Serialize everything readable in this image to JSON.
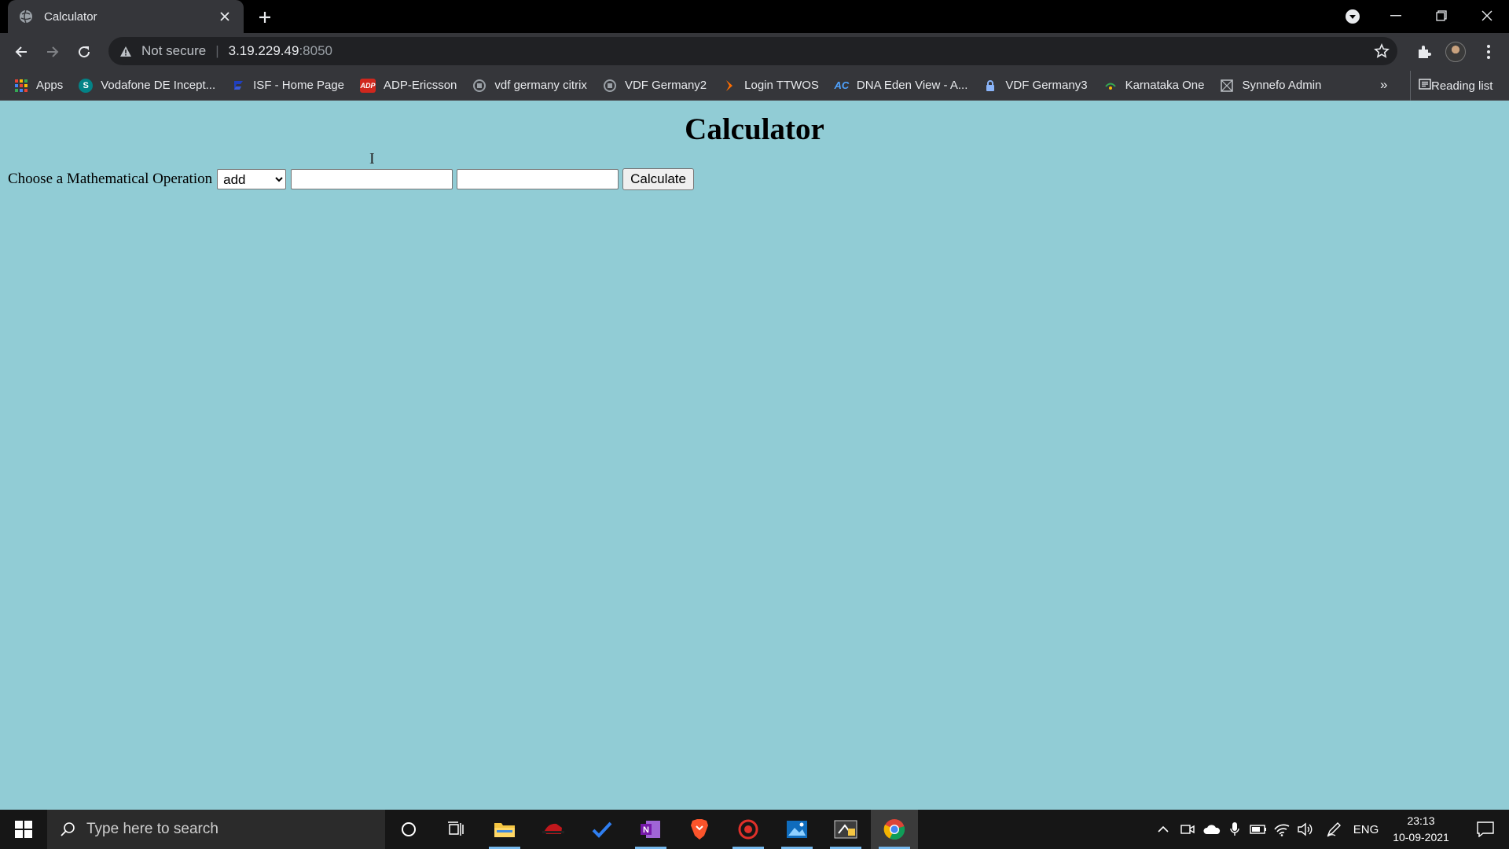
{
  "browser": {
    "tab": {
      "title": "Calculator"
    },
    "address": {
      "not_secure": "Not secure",
      "host": "3.19.229.49",
      "port": ":8050"
    },
    "bookmarks": [
      {
        "label": "Apps",
        "icon": "apps-grid-icon",
        "color": "#4285f4"
      },
      {
        "label": "Vodafone DE Incept...",
        "icon": "sharepoint-icon",
        "color": "#038387"
      },
      {
        "label": "ISF - Home Page",
        "icon": "isf-icon",
        "color": "#1f3fbf"
      },
      {
        "label": "ADP-Ericsson",
        "icon": "adp-icon",
        "color": "#d0271d"
      },
      {
        "label": "vdf germany citrix",
        "icon": "citrix-icon",
        "color": "#9aa0a6"
      },
      {
        "label": "VDF Germany2",
        "icon": "citrix-icon",
        "color": "#9aa0a6"
      },
      {
        "label": "Login TTWOS",
        "icon": "ttwos-icon",
        "color": "#ff6d00"
      },
      {
        "label": "DNA Eden View - A...",
        "icon": "dna-icon",
        "color": "#4fa3ff"
      },
      {
        "label": "VDF Germany3",
        "icon": "lock-icon",
        "color": "#8ab4f8"
      },
      {
        "label": "Karnataka One",
        "icon": "karnataka-icon",
        "color": "#34a853"
      },
      {
        "label": "Synnefo Admin",
        "icon": "synnefo-icon",
        "color": "#bdc1c6"
      }
    ],
    "more": "»",
    "reading_list": "Reading list"
  },
  "page": {
    "title": "Calculator",
    "label": "Choose a Mathematical Operation",
    "operation": {
      "selected": "add"
    },
    "input1": "",
    "input2": "",
    "button": "Calculate"
  },
  "taskbar": {
    "search_placeholder": "Type here to search",
    "language": "ENG",
    "time": "23:13",
    "date": "10-09-2021"
  }
}
